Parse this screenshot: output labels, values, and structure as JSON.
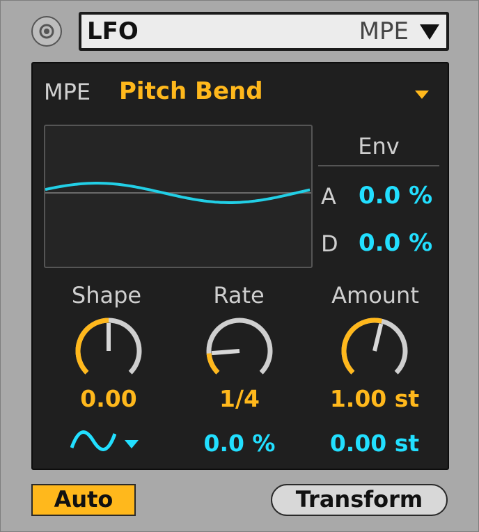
{
  "header": {
    "device_name": "LFO",
    "mode": "MPE"
  },
  "source": {
    "label": "MPE",
    "value": "Pitch Bend"
  },
  "envelope": {
    "title": "Env",
    "attack_label": "A",
    "attack_value": "0.0 %",
    "decay_label": "D",
    "decay_value": "0.0 %"
  },
  "knobs": {
    "shape": {
      "label": "Shape",
      "value": "0.00",
      "level": 0.5
    },
    "rate": {
      "label": "Rate",
      "value": "1/4",
      "level": 0.15
    },
    "amount": {
      "label": "Amount",
      "value": "1.00 st",
      "level": 0.55
    }
  },
  "modulation": {
    "shape_waveform": "sine-wave-icon",
    "rate_mod": "0.0 %",
    "amount_mod": "0.00 st"
  },
  "buttons": {
    "auto_label": "Auto",
    "transform_label": "Transform"
  },
  "colors": {
    "accent_orange": "#ffb81c",
    "accent_cyan": "#22dfff",
    "panel_bg": "#1f1f1f",
    "chrome_bg": "#a9a9a9"
  }
}
